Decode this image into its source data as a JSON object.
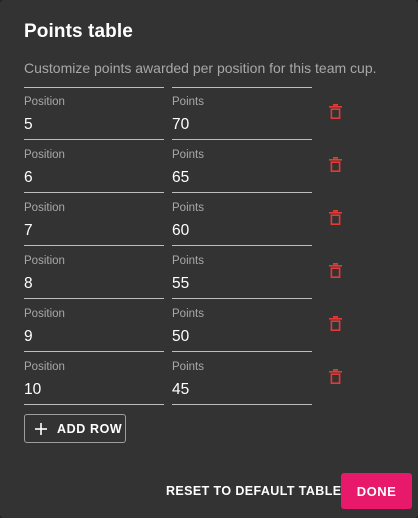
{
  "dialog": {
    "title": "Points table",
    "subtitle": "Customize points awarded per position for this team cup."
  },
  "rows": [
    {
      "position_label": "Position",
      "position": "5",
      "points_label": "Points",
      "points": "70"
    },
    {
      "position_label": "Position",
      "position": "6",
      "points_label": "Points",
      "points": "65"
    },
    {
      "position_label": "Position",
      "position": "7",
      "points_label": "Points",
      "points": "60"
    },
    {
      "position_label": "Position",
      "position": "8",
      "points_label": "Points",
      "points": "55"
    },
    {
      "position_label": "Position",
      "position": "9",
      "points_label": "Points",
      "points": "50"
    },
    {
      "position_label": "Position",
      "position": "10",
      "points_label": "Points",
      "points": "45"
    }
  ],
  "actions": {
    "add_row_label": "ADD ROW",
    "reset_label": "RESET TO DEFAULT TABLE",
    "done_label": "DONE"
  },
  "icons": {
    "delete": "trash-icon",
    "add": "plus-icon"
  },
  "colors": {
    "background": "#333333",
    "delete_icon": "#e53935",
    "primary": "#e8196a"
  }
}
